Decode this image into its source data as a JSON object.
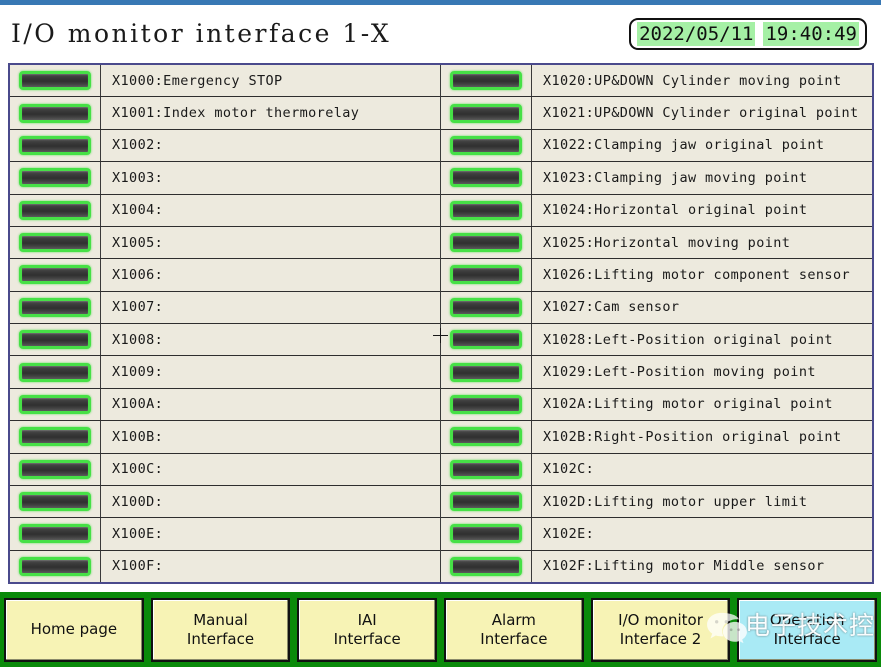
{
  "header": {
    "title": "I/O monitor interface 1-X",
    "date": "2022/05/11",
    "time": "19:40:49"
  },
  "io_table": {
    "left_column": [
      {
        "lamp": "lamp-off",
        "label": "X1000:Emergency STOP"
      },
      {
        "lamp": "lamp-off",
        "label": "X1001:Index motor thermorelay"
      },
      {
        "lamp": "lamp-off",
        "label": "X1002:"
      },
      {
        "lamp": "lamp-off",
        "label": "X1003:"
      },
      {
        "lamp": "lamp-off",
        "label": "X1004:"
      },
      {
        "lamp": "lamp-off",
        "label": "X1005:"
      },
      {
        "lamp": "lamp-off",
        "label": "X1006:"
      },
      {
        "lamp": "lamp-off",
        "label": "X1007:"
      },
      {
        "lamp": "lamp-off",
        "label": "X1008:"
      },
      {
        "lamp": "lamp-off",
        "label": "X1009:"
      },
      {
        "lamp": "lamp-off",
        "label": "X100A:"
      },
      {
        "lamp": "lamp-off",
        "label": "X100B:"
      },
      {
        "lamp": "lamp-off",
        "label": "X100C:"
      },
      {
        "lamp": "lamp-off",
        "label": "X100D:"
      },
      {
        "lamp": "lamp-off",
        "label": "X100E:"
      },
      {
        "lamp": "lamp-off",
        "label": "X100F:"
      }
    ],
    "right_column": [
      {
        "lamp": "lamp-off",
        "label": "X1020:UP&DOWN Cylinder moving point"
      },
      {
        "lamp": "lamp-off",
        "label": "X1021:UP&DOWN Cylinder original point"
      },
      {
        "lamp": "lamp-off",
        "label": "X1022:Clamping jaw original point"
      },
      {
        "lamp": "lamp-off",
        "label": "X1023:Clamping jaw moving point"
      },
      {
        "lamp": "lamp-off",
        "label": "X1024:Horizontal original point"
      },
      {
        "lamp": "lamp-off",
        "label": "X1025:Horizontal moving point"
      },
      {
        "lamp": "lamp-off",
        "label": "X1026:Lifting motor component sensor"
      },
      {
        "lamp": "lamp-off",
        "label": "X1027:Cam sensor"
      },
      {
        "lamp": "lamp-off",
        "label": "X1028:Left-Position original point"
      },
      {
        "lamp": "lamp-off",
        "label": "X1029:Left-Position moving point"
      },
      {
        "lamp": "lamp-off",
        "label": "X102A:Lifting motor original point"
      },
      {
        "lamp": "lamp-off",
        "label": "X102B:Right-Position original point"
      },
      {
        "lamp": "lamp-off",
        "label": "X102C:"
      },
      {
        "lamp": "lamp-off",
        "label": "X102D:Lifting motor upper limit"
      },
      {
        "lamp": "lamp-off",
        "label": "X102E:"
      },
      {
        "lamp": "lamp-off",
        "label": "X102F:Lifting motor Middle sensor"
      }
    ]
  },
  "navbar": {
    "buttons": [
      {
        "label": "Home page",
        "accent": false
      },
      {
        "label": "Manual\nInterface",
        "accent": false
      },
      {
        "label": "IAI\nInterface",
        "accent": false
      },
      {
        "label": "Alarm\nInterface",
        "accent": false
      },
      {
        "label": "I/O monitor\nInterface 2",
        "accent": false
      },
      {
        "label": "Operation\nInterface",
        "accent": true
      }
    ]
  },
  "watermark": {
    "logo": "wechat-icon",
    "text": "电子技术控"
  },
  "colors": {
    "lamp_border_green": "#46e046",
    "lamp_body_dark": "#3b3b3b",
    "navbar_green": "#0a8a0a",
    "button_yellow": "#f7f3b5",
    "button_accent_cyan": "#a9eaf5",
    "datetime_green": "#a5f0a5",
    "table_background": "#ece9dd",
    "table_border": "#4a4a8c",
    "top_strip_blue": "#3878b4"
  }
}
